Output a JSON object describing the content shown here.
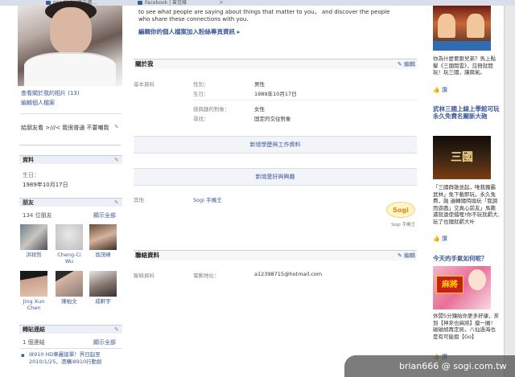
{
  "browser_tabs": [
    {
      "title": "good job! 官方網..."
    },
    {
      "title": "Facebook | 曾昱維"
    }
  ],
  "profile": {
    "view_photos": "查看關於我的相片 (13)",
    "edit_profile": "編輯個人檔案",
    "status": "給朋友看 >///< 我很普通 不要嘲我"
  },
  "info_box": {
    "title": "資料",
    "birthday_label": "生日：",
    "birthday_value": "1989年10月17日"
  },
  "friends_box": {
    "title": "朋友",
    "count": "134 位朋友",
    "see_all": "顯示全部",
    "friends": [
      {
        "name": "洪祥哲"
      },
      {
        "name": "Cheng-Ci Wu"
      },
      {
        "name": "翁茂峰"
      },
      {
        "name": "Jing Xun Chen"
      },
      {
        "name": "陳柏文"
      },
      {
        "name": "成軒宇"
      }
    ]
  },
  "links_box": {
    "title": "轉貼連結",
    "count": "1 個連結",
    "see_all": "顯示全部",
    "item": "i8910 HD華麗搶單！界日起至 2010/1/25，憑購i8910行動創"
  },
  "intro": {
    "line1": "to see what people are saying about things that matter to you， and discover the people",
    "line2": "who share these connections with you.",
    "link": "編輯你的個人檔案加入粉絲專頁資訊 ▸"
  },
  "about": {
    "title": "關於我",
    "edit": "編輯",
    "basic_label": "基本資料",
    "gender_label": "性別：",
    "gender_value": "男性",
    "birthday_label": "生日：",
    "birthday_value": "1989年10月17日",
    "interest_label": "感興趣的對象：",
    "interest_value": "女性",
    "looking_label": "尋找：",
    "looking_value": "固定的交往對象",
    "add_education": "新增學歷與工作資料",
    "add_hobbies": "新增愛好與興趣",
    "other_label": "其他",
    "other_value": "Sogi 手機王",
    "sogi_caption": "Sogi 手機王"
  },
  "contact": {
    "title": "聯絡資料",
    "edit": "編輯",
    "label": "聯絡資料",
    "email_label": "電郵地址：",
    "email_value": "a12398715@hotmail.com"
  },
  "ads": [
    {
      "text": "你為什麼要跟兒弟？馬上點擊《三國閱雲》，註冊就開玩！玩三國，讓興氣。",
      "like": "讚"
    },
    {
      "title": "武林三國上線上學館可玩永久免費名關新大砲",
      "img_text": "三國",
      "text": "「三國群雄並起，唯我獨霸武林」免下載即玩，永久免費，融 遍轉隨時換玩「我調而遊戲」交真心前友」馬瞻邁就遠使擂哩!你不玩就虧大,玩了也隨就虧大叶",
      "like": "讚"
    },
    {
      "title": "今天的手氣如何呢？",
      "img_text": "麻將",
      "text": "休閒5分鐘給你更多好康，來到【神來也麻將】摸一圈！磁磁胡再定局，八仙過海也是有可能摺【Go】",
      "like": "讚"
    }
  ],
  "watermark": "brian666 @ sogi.com.tw"
}
